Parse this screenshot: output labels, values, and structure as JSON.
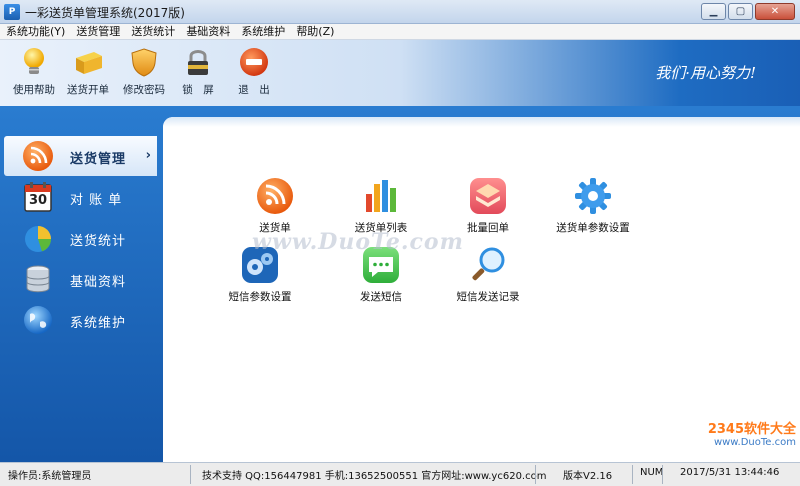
{
  "window": {
    "title": "一彩送货单管理系统(2017版)",
    "icon": "app-logo-icon"
  },
  "window_buttons": [
    "minimize",
    "maximize",
    "close"
  ],
  "menu": [
    "系统功能(Y)",
    "送货管理",
    "送货统计",
    "基础资料",
    "系统维护",
    "帮助(Z)"
  ],
  "toolbar": {
    "items": [
      {
        "label": "使用帮助",
        "icon": "lightbulb-icon"
      },
      {
        "label": "送货开单",
        "icon": "folder-icon"
      },
      {
        "label": "修改密码",
        "icon": "shield-icon"
      },
      {
        "label": "锁　屏",
        "icon": "lock-icon"
      },
      {
        "label": "退　出",
        "icon": "exit-icon"
      }
    ],
    "slogan": "我们·用心努力!"
  },
  "sidebar": {
    "items": [
      {
        "label": "送货管理",
        "icon": "rss-icon",
        "active": true
      },
      {
        "label": "对 账 单",
        "icon": "calendar-icon",
        "calendar_day": "30"
      },
      {
        "label": "送货统计",
        "icon": "pie-chart-icon"
      },
      {
        "label": "基础资料",
        "icon": "database-icon"
      },
      {
        "label": "系统维护",
        "icon": "globe-icon"
      }
    ]
  },
  "functions": [
    {
      "label": "送货单",
      "icon": "rss-icon"
    },
    {
      "label": "送货单列表",
      "icon": "bar-chart-icon"
    },
    {
      "label": "批量回单",
      "icon": "layers-icon"
    },
    {
      "label": "送货单参数设置",
      "icon": "gear-icon"
    },
    {
      "label": "短信参数设置",
      "icon": "gears-icon"
    },
    {
      "label": "发送短信",
      "icon": "chat-icon"
    },
    {
      "label": "短信发送记录",
      "icon": "magnifier-icon"
    }
  ],
  "watermark": "www.DuoTe.com",
  "corner_watermark": {
    "brand": "2345软件大全",
    "site": "www.DuoTe.com"
  },
  "status": {
    "operator": "操作员:系统管理员",
    "support": "技术支持 QQ:156447981 手机:13652500551 官方网址:www.yc620.com",
    "version": "版本V2.16",
    "num": "NUM",
    "datetime": "2017/5/31 13:44:46"
  }
}
